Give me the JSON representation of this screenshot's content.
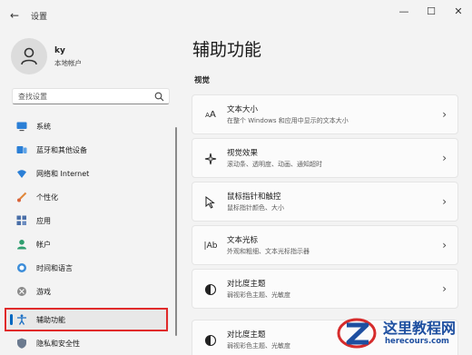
{
  "window": {
    "title": "设置",
    "back_icon": "back-arrow-icon",
    "controls": {
      "minimize": "—",
      "maximize": "☐",
      "close": "✕"
    }
  },
  "profile": {
    "name": "ky",
    "account_type": "本地帐户"
  },
  "search": {
    "placeholder": "查找设置"
  },
  "sidebar": {
    "items": [
      {
        "label": "系统",
        "icon": "system-icon"
      },
      {
        "label": "蓝牙和其他设备",
        "icon": "bluetooth-icon"
      },
      {
        "label": "网络和 Internet",
        "icon": "wifi-icon"
      },
      {
        "label": "个性化",
        "icon": "brush-icon"
      },
      {
        "label": "应用",
        "icon": "apps-icon"
      },
      {
        "label": "帐户",
        "icon": "account-icon"
      },
      {
        "label": "时间和语言",
        "icon": "globe-clock-icon"
      },
      {
        "label": "游戏",
        "icon": "xbox-icon"
      },
      {
        "label": "辅助功能",
        "icon": "accessibility-icon",
        "selected": true
      },
      {
        "label": "隐私和安全性",
        "icon": "shield-icon"
      }
    ]
  },
  "main": {
    "title": "辅助功能",
    "section": "视觉",
    "cards": [
      {
        "title": "文本大小",
        "subtitle": "在整个 Windows 和应用中显示的文本大小",
        "icon": "text-size-icon"
      },
      {
        "title": "视觉效果",
        "subtitle": "滚动条、透明度、动画、通知超时",
        "icon": "sparkle-icon"
      },
      {
        "title": "鼠标指针和触控",
        "subtitle": "鼠标指针颜色、大小",
        "icon": "mouse-pointer-icon"
      },
      {
        "title": "文本光标",
        "subtitle": "外观和粗细、文本光标指示器",
        "icon": "text-cursor-icon"
      },
      {
        "title": "对比度主题",
        "subtitle": "弱视彩色主题、光敏度",
        "icon": "contrast-icon"
      },
      {
        "title": "对比度主题",
        "subtitle": "弱视彩色主题、光敏度",
        "icon": "contrast-icon"
      }
    ]
  },
  "watermark": {
    "title": "这里教程网",
    "url": "herecours.com"
  },
  "colors": {
    "accent": "#0067c0",
    "highlight_border": "#e02a2a",
    "watermark": "#1e4fa0"
  }
}
